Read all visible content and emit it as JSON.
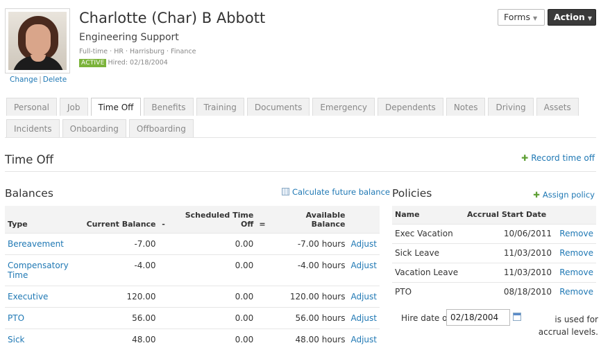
{
  "employee": {
    "name": "Charlotte (Char) B Abbott",
    "department": "Engineering Support",
    "meta": "Full-time · HR · Harrisburg · Finance",
    "status_badge": "ACTIVE",
    "hired": "Hired: 02/18/2004",
    "photo_change": "Change",
    "photo_sep": "|",
    "photo_delete": "Delete"
  },
  "buttons": {
    "forms": "Forms",
    "action": "Action"
  },
  "tabs_row1": [
    "Personal",
    "Job",
    "Time Off",
    "Benefits",
    "Training",
    "Documents",
    "Emergency",
    "Dependents",
    "Notes",
    "Driving",
    "Assets"
  ],
  "tabs_row2": [
    "Incidents",
    "Onboarding",
    "Offboarding"
  ],
  "active_tab": "Time Off",
  "section": {
    "title": "Time Off",
    "record_link": "Record time off"
  },
  "balances": {
    "title": "Balances",
    "calc_link": "Calculate future balance",
    "headers": {
      "type": "Type",
      "current": "Current Balance",
      "minus": "-",
      "scheduled": "Scheduled Time Off",
      "equals": "=",
      "available": "Available Balance"
    },
    "rows": [
      {
        "type": "Bereavement",
        "current": "-7.00",
        "scheduled": "0.00",
        "available": "-7.00 hours",
        "action": "Adjust"
      },
      {
        "type": "Compensatory Time",
        "current": "-4.00",
        "scheduled": "0.00",
        "available": "-4.00 hours",
        "action": "Adjust"
      },
      {
        "type": "Executive",
        "current": "120.00",
        "scheduled": "0.00",
        "available": "120.00 hours",
        "action": "Adjust"
      },
      {
        "type": "PTO",
        "current": "56.00",
        "scheduled": "0.00",
        "available": "56.00 hours",
        "action": "Adjust"
      },
      {
        "type": "Sick",
        "current": "48.00",
        "scheduled": "0.00",
        "available": "48.00 hours",
        "action": "Adjust"
      }
    ]
  },
  "policies": {
    "title": "Policies",
    "assign_link": "Assign policy",
    "headers": {
      "name": "Name",
      "start": "Accrual Start Date"
    },
    "rows": [
      {
        "name": "Exec Vacation",
        "start": "10/06/2011",
        "action": "Remove"
      },
      {
        "name": "Sick Leave",
        "start": "11/03/2010",
        "action": "Remove"
      },
      {
        "name": "Vacation Leave",
        "start": "11/03/2010",
        "action": "Remove"
      },
      {
        "name": "PTO",
        "start": "08/18/2010",
        "action": "Remove"
      }
    ],
    "hire_label_before": "Hire date of",
    "hire_value": "02/18/2004",
    "hire_label_after": "is used for accrual levels."
  },
  "colors": {
    "link": "#1f78b4",
    "active_badge": "#7bb33a",
    "add_plus": "#5fa036",
    "action_button": "#3a3a3a"
  }
}
